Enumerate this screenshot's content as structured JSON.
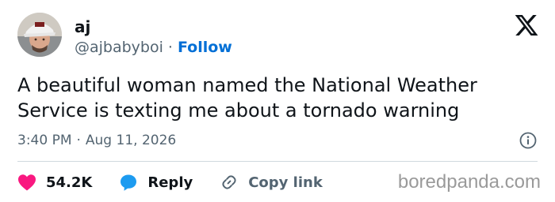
{
  "tweet": {
    "author": {
      "name": "aj",
      "handle": "@ajbabyboi",
      "separator": "·",
      "follow_label": "Follow"
    },
    "text": "A beautiful woman named the National Weather Service is texting me about a tornado warning",
    "timestamp": {
      "time": "3:40 PM",
      "separator": "·",
      "date": "Aug 11, 2026"
    },
    "actions": {
      "like_count": "54.2K",
      "reply_label": "Reply",
      "copy_link_label": "Copy link"
    }
  },
  "watermark": "boredpanda.com",
  "icons": {
    "platform": "x-logo-icon",
    "info": "info-icon",
    "like": "heart-icon",
    "reply": "speech-bubble-icon",
    "copy": "link-icon"
  },
  "colors": {
    "follow": "#006fd6",
    "like": "#f91880",
    "reply": "#1d9bf0",
    "muted": "#536471",
    "text": "#0f1419"
  }
}
